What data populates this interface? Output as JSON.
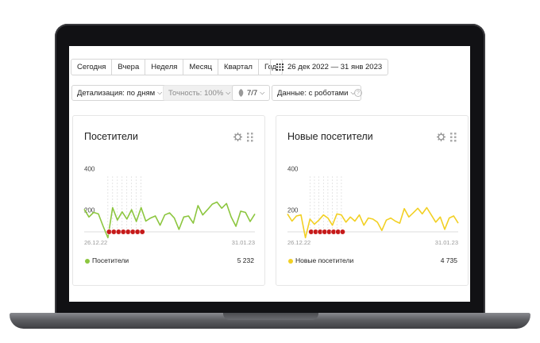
{
  "toolbar": {
    "periods": [
      "Сегодня",
      "Вчера",
      "Неделя",
      "Месяц",
      "Квартал",
      "Год"
    ],
    "date_range": "26 дек 2022 — 31 янв 2023",
    "detail": "Детализация: по дням",
    "accuracy": "Точность: 100%",
    "attribution": "7/7",
    "data_filter": "Данные: с роботами",
    "help": "?"
  },
  "widgets": [
    {
      "title": "Посетители",
      "legend_label": "Посетители",
      "total": "5 232",
      "color": "#8cc63f"
    },
    {
      "title": "Новые посетители",
      "legend_label": "Новые посетители",
      "total": "4 735",
      "color": "#f2d024"
    }
  ],
  "chart_data": [
    {
      "type": "line",
      "title": "Посетители",
      "y_ticks": [
        200,
        400
      ],
      "ylim": [
        80,
        440
      ],
      "x_start_label": "26.12.22",
      "x_end_label": "31.01.23",
      "holiday_markers": 8,
      "series": [
        {
          "name": "Посетители",
          "color": "#8cc63f",
          "values": [
            228,
            190,
            212,
            205,
            145,
            90,
            235,
            175,
            215,
            180,
            225,
            168,
            235,
            170,
            185,
            195,
            150,
            200,
            210,
            185,
            130,
            190,
            195,
            160,
            245,
            200,
            225,
            252,
            262,
            232,
            255,
            190,
            145,
            218,
            212,
            168,
            205
          ]
        }
      ]
    },
    {
      "type": "line",
      "title": "Новые посетители",
      "y_ticks": [
        200,
        400
      ],
      "ylim": [
        80,
        440
      ],
      "x_start_label": "26.12.22",
      "x_end_label": "31.01.23",
      "holiday_markers": 8,
      "series": [
        {
          "name": "Новые посетители",
          "color": "#f2d024",
          "values": [
            205,
            170,
            195,
            200,
            90,
            180,
            155,
            175,
            200,
            185,
            150,
            205,
            200,
            165,
            190,
            170,
            200,
            150,
            185,
            180,
            165,
            125,
            175,
            185,
            170,
            160,
            230,
            190,
            210,
            232,
            205,
            235,
            200,
            165,
            190,
            130,
            185,
            195,
            160
          ]
        }
      ]
    }
  ]
}
